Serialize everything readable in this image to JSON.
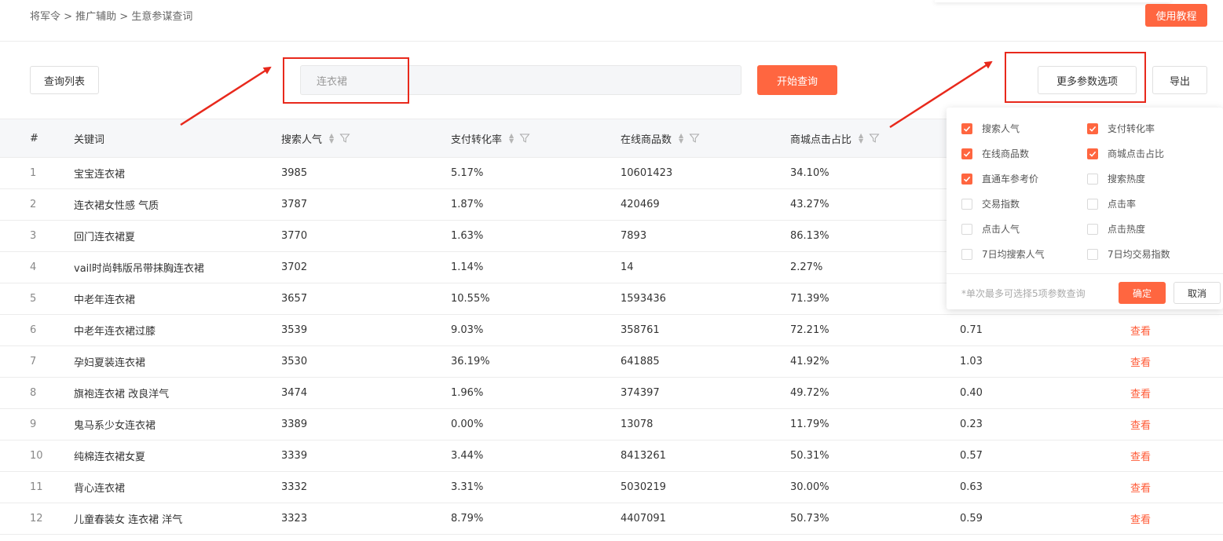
{
  "breadcrumb": "将军令 > 推广辅助 > 生意参谋查词",
  "tutorial_button": "使用教程",
  "toolbar": {
    "query_list": "查询列表",
    "search_value": "连衣裙",
    "start_query": "开始查询",
    "more_params": "更多参数选项",
    "export": "导出"
  },
  "table": {
    "headers": [
      "#",
      "关键词",
      "搜索人气",
      "支付转化率",
      "在线商品数",
      "商城点击占比"
    ],
    "rows": [
      {
        "idx": "1",
        "kw": "宝宝连衣裙",
        "pop": "3985",
        "conv": "5.17%",
        "items": "10601423",
        "mall": "34.10%",
        "extra": "",
        "action": ""
      },
      {
        "idx": "2",
        "kw": "连衣裙女性感 气质",
        "pop": "3787",
        "conv": "1.87%",
        "items": "420469",
        "mall": "43.27%",
        "extra": "",
        "action": ""
      },
      {
        "idx": "3",
        "kw": "回门连衣裙夏",
        "pop": "3770",
        "conv": "1.63%",
        "items": "7893",
        "mall": "86.13%",
        "extra": "",
        "action": ""
      },
      {
        "idx": "4",
        "kw": "vail时尚韩版吊带抹胸连衣裙",
        "pop": "3702",
        "conv": "1.14%",
        "items": "14",
        "mall": "2.27%",
        "extra": "",
        "action": ""
      },
      {
        "idx": "5",
        "kw": "中老年连衣裙",
        "pop": "3657",
        "conv": "10.55%",
        "items": "1593436",
        "mall": "71.39%",
        "extra": "",
        "action": ""
      },
      {
        "idx": "6",
        "kw": "中老年连衣裙过膝",
        "pop": "3539",
        "conv": "9.03%",
        "items": "358761",
        "mall": "72.21%",
        "extra": "0.71",
        "action": "查看"
      },
      {
        "idx": "7",
        "kw": "孕妇夏装连衣裙",
        "pop": "3530",
        "conv": "36.19%",
        "items": "641885",
        "mall": "41.92%",
        "extra": "1.03",
        "action": "查看"
      },
      {
        "idx": "8",
        "kw": "旗袍连衣裙 改良洋气",
        "pop": "3474",
        "conv": "1.96%",
        "items": "374397",
        "mall": "49.72%",
        "extra": "0.40",
        "action": "查看"
      },
      {
        "idx": "9",
        "kw": "鬼马系少女连衣裙",
        "pop": "3389",
        "conv": "0.00%",
        "items": "13078",
        "mall": "11.79%",
        "extra": "0.23",
        "action": "查看"
      },
      {
        "idx": "10",
        "kw": "纯棉连衣裙女夏",
        "pop": "3339",
        "conv": "3.44%",
        "items": "8413261",
        "mall": "50.31%",
        "extra": "0.57",
        "action": "查看"
      },
      {
        "idx": "11",
        "kw": "背心连衣裙",
        "pop": "3332",
        "conv": "3.31%",
        "items": "5030219",
        "mall": "30.00%",
        "extra": "0.63",
        "action": "查看"
      },
      {
        "idx": "12",
        "kw": "儿童春装女 连衣裙 洋气",
        "pop": "3323",
        "conv": "8.79%",
        "items": "4407091",
        "mall": "50.73%",
        "extra": "0.59",
        "action": "查看"
      }
    ]
  },
  "popup": {
    "options": [
      {
        "label": "搜索人气",
        "checked": true
      },
      {
        "label": "支付转化率",
        "checked": true
      },
      {
        "label": "在线商品数",
        "checked": true
      },
      {
        "label": "商城点击占比",
        "checked": true
      },
      {
        "label": "直通车参考价",
        "checked": true
      },
      {
        "label": "搜索热度",
        "checked": false
      },
      {
        "label": "交易指数",
        "checked": false
      },
      {
        "label": "点击率",
        "checked": false
      },
      {
        "label": "点击人气",
        "checked": false
      },
      {
        "label": "点击热度",
        "checked": false
      },
      {
        "label": "7日均搜索人气",
        "checked": false
      },
      {
        "label": "7日均交易指数",
        "checked": false
      }
    ],
    "note": "*单次最多可选择5项参数查询",
    "ok": "确定",
    "cancel": "取消"
  },
  "colors": {
    "accent": "#ff6640",
    "annotation": "#e8291c",
    "link": "#ff5a36"
  }
}
